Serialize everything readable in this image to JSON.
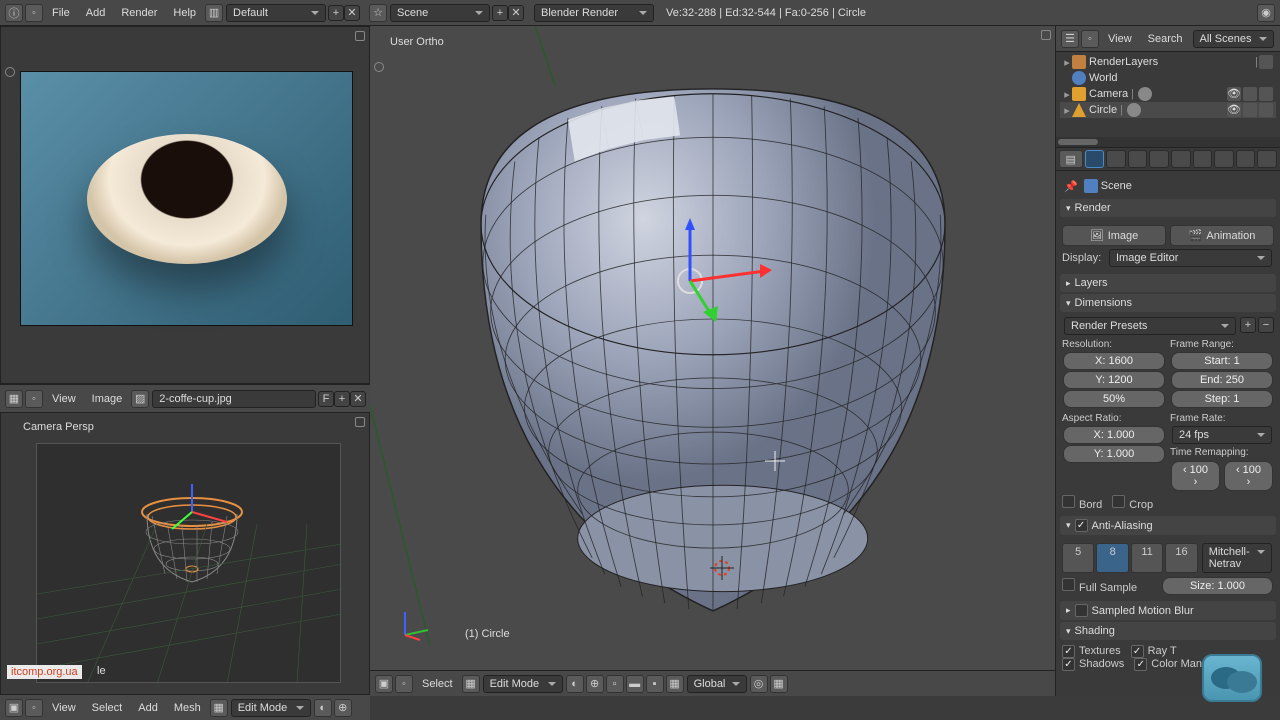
{
  "topbar": {
    "menus": [
      "File",
      "Add",
      "Render",
      "Help"
    ],
    "layout_dropdown": "Default",
    "scene_dropdown": "Scene",
    "engine_dropdown": "Blender Render",
    "stats": "Ve:32-288 | Ed:32-544 | Fa:0-256 | Circle"
  },
  "image_editor": {
    "menus": [
      "View",
      "Image"
    ],
    "filename": "2-coffe-cup.jpg",
    "flag": "F"
  },
  "camera_panel": {
    "label": "Camera Persp",
    "object_suffix": "le",
    "watermark": "itcomp.org.ua"
  },
  "viewport": {
    "label": "User Ortho",
    "object": "(1) Circle",
    "footer": {
      "menus": [
        "View",
        "Select",
        "Add",
        "Mesh"
      ],
      "mode": "Edit Mode",
      "orientation": "Global"
    },
    "mini_footer": {
      "select_menu": "Select",
      "mode": "Edit Mode"
    }
  },
  "outliner_header": {
    "view": "View",
    "search": "Search",
    "filter": "All Scenes"
  },
  "outliner": {
    "items": [
      {
        "name": "RenderLayers",
        "indent": 1
      },
      {
        "name": "World",
        "indent": 1
      },
      {
        "name": "Camera",
        "indent": 1
      },
      {
        "name": "Circle",
        "indent": 1
      }
    ]
  },
  "properties": {
    "breadcrumb": "Scene",
    "render_panel": "Render",
    "render_buttons": {
      "image": "Image",
      "animation": "Animation"
    },
    "display_label": "Display:",
    "display_value": "Image Editor",
    "layers_panel": "Layers",
    "dimensions_panel": "Dimensions",
    "render_presets": "Render Presets",
    "resolution_label": "Resolution:",
    "frame_range_label": "Frame Range:",
    "res_x": "X: 1600",
    "res_y": "Y: 1200",
    "res_pct": "50%",
    "frame_start": "Start: 1",
    "frame_end": "End: 250",
    "frame_step": "Step: 1",
    "aspect_label": "Aspect Ratio:",
    "frame_rate_label": "Frame Rate:",
    "aspect_x": "X: 1.000",
    "aspect_y": "Y: 1.000",
    "fps": "24 fps",
    "time_remap_label": "Time Remapping:",
    "remap_old": "‹ 100 ›",
    "remap_new": "‹ 100 ›",
    "bord": "Bord",
    "crop": "Crop",
    "aa_panel": "Anti-Aliasing",
    "aa_samples": [
      "5",
      "8",
      "11",
      "16"
    ],
    "aa_filter": "Mitchell-Netrav",
    "full_sample": "Full Sample",
    "aa_size": "Size: 1.000",
    "motion_blur_panel": "Sampled Motion Blur",
    "shading_panel": "Shading",
    "textures": "Textures",
    "ray_t": "Ray T",
    "shadows": "Shadows",
    "color_manage": "Color Managem"
  },
  "bottom": {
    "menus": [
      "View"
    ],
    "mode": "Edit Mode"
  }
}
